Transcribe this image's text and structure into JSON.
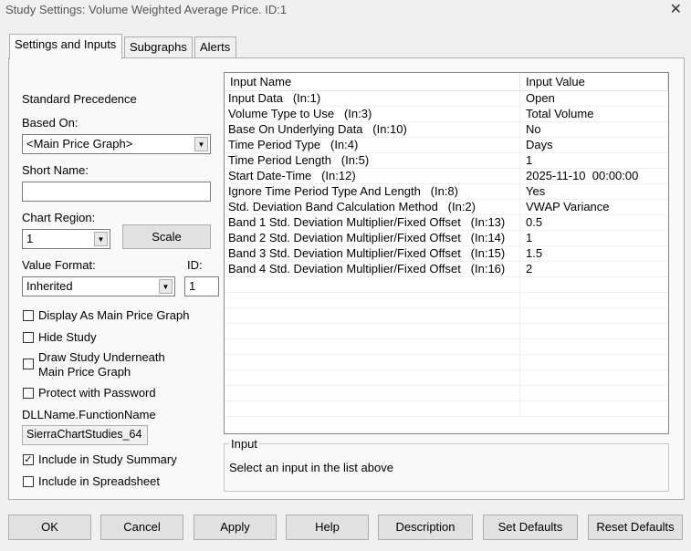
{
  "window": {
    "title": "Study Settings: Volume Weighted Average Price. ID:1",
    "close": "✕"
  },
  "tabs": [
    "Settings and Inputs",
    "Subgraphs",
    "Alerts"
  ],
  "left": {
    "precedence": "Standard Precedence",
    "based_on_label": "Based On:",
    "based_on_value": "<Main Price Graph>",
    "short_name_label": "Short Name:",
    "short_name_value": "",
    "chart_region_label": "Chart Region:",
    "chart_region_value": "1",
    "scale_button": "Scale",
    "value_format_label": "Value Format:",
    "value_format_value": "Inherited",
    "id_label": "ID:",
    "id_value": "1",
    "checkboxes": [
      {
        "label": "Display As Main Price Graph",
        "checked": false
      },
      {
        "label": "Hide Study",
        "checked": false
      },
      {
        "label": "Draw Study Underneath",
        "label2": "Main Price Graph",
        "checked": false
      },
      {
        "label": "Protect with Password",
        "checked": false
      }
    ],
    "dll_label": "DLLName.FunctionName",
    "dll_value": "SierraChartStudies_64",
    "include_summary": {
      "label": "Include in Study Summary",
      "checked": true,
      "mark": "✓"
    },
    "include_spreadsheet": {
      "label": "Include in Spreadsheet",
      "checked": false
    }
  },
  "table": {
    "headers": [
      "Input Name",
      "Input Value"
    ],
    "rows": [
      [
        "Input Data   (In:1)",
        "Open"
      ],
      [
        "Volume Type to Use   (In:3)",
        "Total Volume"
      ],
      [
        "Base On Underlying Data   (In:10)",
        "No"
      ],
      [
        "Time Period Type   (In:4)",
        "Days"
      ],
      [
        "Time Period Length   (In:5)",
        "1"
      ],
      [
        "Start Date-Time   (In:12)",
        "2025-11-10  00:00:00"
      ],
      [
        "Ignore Time Period Type And Length   (In:8)",
        "Yes"
      ],
      [
        "Std. Deviation Band Calculation Method   (In:2)",
        "VWAP Variance"
      ],
      [
        "Band 1 Std. Deviation Multiplier/Fixed Offset   (In:13)",
        "0.5"
      ],
      [
        "Band 2 Std. Deviation Multiplier/Fixed Offset   (In:14)",
        "1"
      ],
      [
        "Band 3 Std. Deviation Multiplier/Fixed Offset   (In:15)",
        "1.5"
      ],
      [
        "Band 4 Std. Deviation Multiplier/Fixed Offset   (In:16)",
        "2"
      ]
    ]
  },
  "input_group": {
    "title": "Input",
    "text": "Select an input in the list above"
  },
  "buttons": [
    "OK",
    "Cancel",
    "Apply",
    "Help",
    "Description",
    "Set Defaults",
    "Reset Defaults"
  ]
}
